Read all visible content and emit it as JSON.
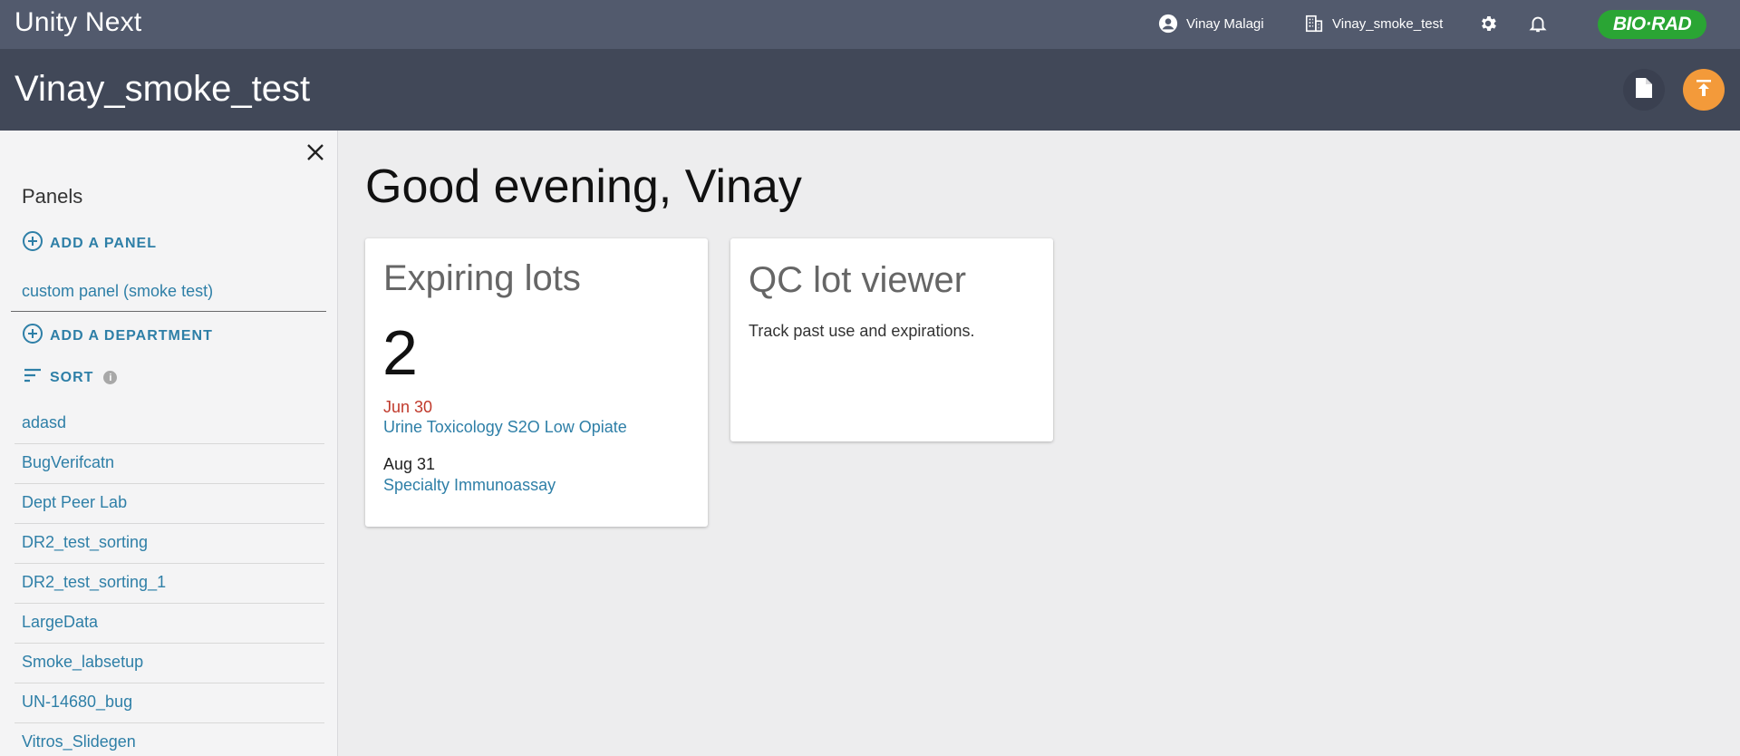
{
  "header": {
    "app_title": "Unity Next",
    "user_name": "Vinay Malagi",
    "lab_name": "Vinay_smoke_test",
    "logo_text": "BIO·RAD",
    "brand_color": "#2aa534"
  },
  "subheader": {
    "title": "Vinay_smoke_test",
    "accent_color": "#f39a3a"
  },
  "sidebar": {
    "panels_title": "Panels",
    "add_panel_label": "ADD A PANEL",
    "panels": [
      "custom panel (smoke test)"
    ],
    "add_department_label": "ADD A DEPARTMENT",
    "sort_label": "SORT",
    "departments": [
      "adasd",
      "BugVerifcatn",
      "Dept Peer Lab",
      "DR2_test_sorting",
      "DR2_test_sorting_1",
      "LargeData",
      "Smoke_labsetup",
      "UN-14680_bug",
      "Vitros_Slidegen"
    ]
  },
  "main": {
    "greeting": "Good evening, Vinay",
    "expiring_card": {
      "title": "Expiring lots",
      "count": "2",
      "lots": [
        {
          "date": "Jun 30",
          "name": "Urine Toxicology S2O Low Opiate",
          "date_color": "#c0392b"
        },
        {
          "date": "Aug 31",
          "name": "Specialty Immunoassay",
          "date_color": "#222222"
        }
      ]
    },
    "qc_card": {
      "title": "QC lot viewer",
      "description": "Track past use and expirations."
    }
  }
}
